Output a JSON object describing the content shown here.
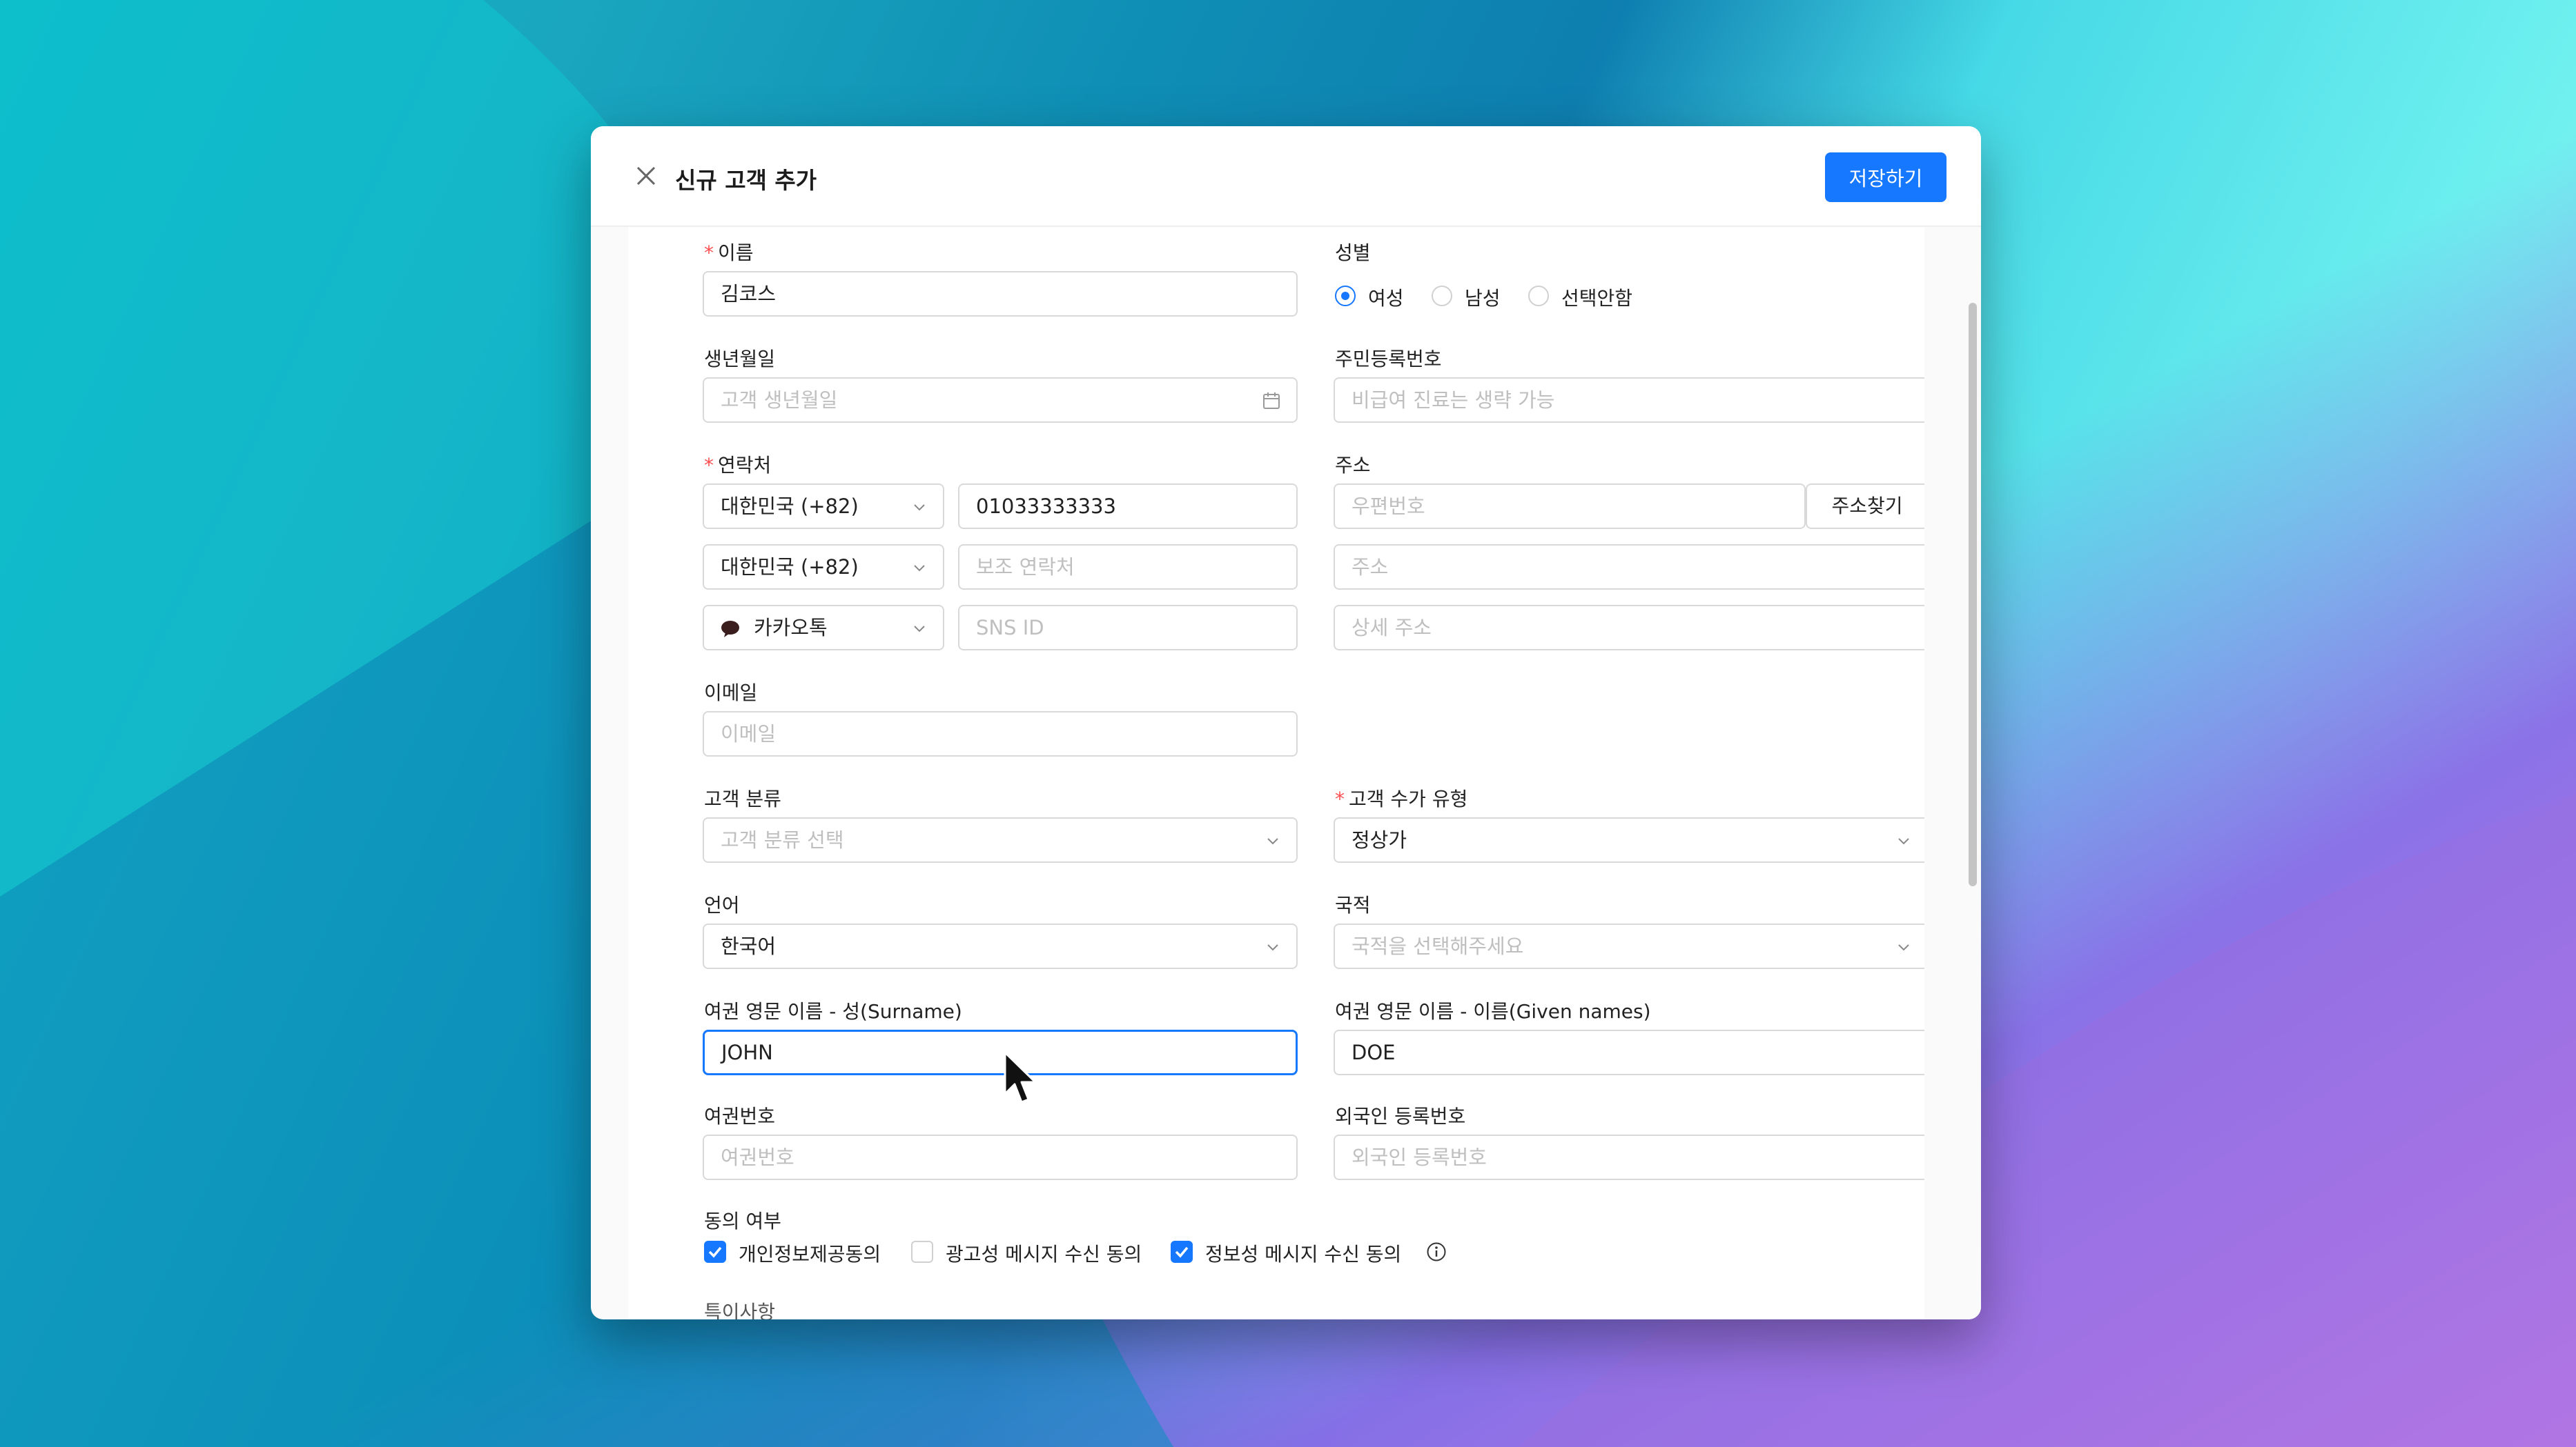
{
  "header": {
    "title": "신규 고객 추가",
    "save_label": "저장하기"
  },
  "form": {
    "name": {
      "label": "이름",
      "value": "김코스"
    },
    "gender": {
      "label": "성별",
      "options": [
        "여성",
        "남성",
        "선택안함"
      ],
      "selected": "여성"
    },
    "birth": {
      "label": "생년월일",
      "placeholder": "고객 생년월일"
    },
    "rrn": {
      "label": "주민등록번호",
      "placeholder": "비급여 진료는 생략 가능"
    },
    "contact": {
      "label": "연락처",
      "country1": "대한민국 (+82)",
      "phone1": "01033333333",
      "country2": "대한민국 (+82)",
      "phone2_placeholder": "보조 연락처",
      "sns": "카카오톡",
      "sns_placeholder": "SNS ID"
    },
    "address": {
      "label": "주소",
      "zip_placeholder": "우편번호",
      "find_label": "주소찾기",
      "addr_placeholder": "주소",
      "detail_placeholder": "상세 주소"
    },
    "email": {
      "label": "이메일",
      "placeholder": "이메일"
    },
    "category": {
      "label": "고객 분류",
      "placeholder": "고객 분류 선택"
    },
    "fee_type": {
      "label": "고객 수가 유형",
      "value": "정상가"
    },
    "language": {
      "label": "언어",
      "value": "한국어"
    },
    "nationality": {
      "label": "국적",
      "placeholder": "국적을 선택해주세요"
    },
    "surname": {
      "label": "여권 영문 이름 - 성(Surname)",
      "value": "JOHN"
    },
    "given": {
      "label": "여권 영문 이름 - 이름(Given names)",
      "value": "DOE"
    },
    "passport": {
      "label": "여권번호",
      "placeholder": "여권번호"
    },
    "alien": {
      "label": "외국인 등록번호",
      "placeholder": "외국인 등록번호"
    },
    "consent": {
      "label": "동의 여부",
      "items": [
        {
          "label": "개인정보제공동의",
          "checked": true
        },
        {
          "label": "광고성 메시지 수신 동의",
          "checked": false
        },
        {
          "label": "정보성 메시지 수신 동의",
          "checked": true
        }
      ]
    },
    "notes_label": "특이사항"
  },
  "colors": {
    "accent": "#1677ff",
    "required": "#ff4d4f",
    "border": "#d9d9d9"
  }
}
